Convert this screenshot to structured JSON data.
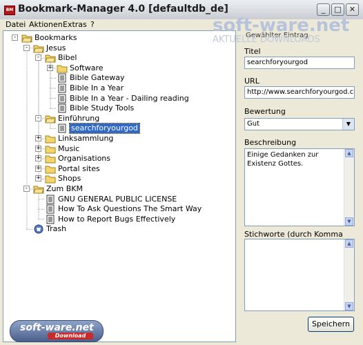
{
  "window": {
    "title": "Bookmark-Manager 4.0 [defaultdb_de]",
    "app_icon_text": "BM",
    "controls": {
      "minimize": "_",
      "maximize": "□",
      "close": "✕"
    }
  },
  "menubar": [
    "Datei",
    "Aktionen",
    "Extras",
    "?"
  ],
  "tree": [
    {
      "label": "Bookmarks",
      "type": "folder",
      "level": 0,
      "expander": "-"
    },
    {
      "label": "Jesus",
      "type": "folder",
      "level": 1,
      "expander": "-"
    },
    {
      "label": "Bibel",
      "type": "folder",
      "level": 2,
      "expander": "-"
    },
    {
      "label": "Software",
      "type": "folder",
      "level": 3,
      "expander": "+"
    },
    {
      "label": "Bible Gateway",
      "type": "doc",
      "level": 3
    },
    {
      "label": "Bible In a Year",
      "type": "doc",
      "level": 3
    },
    {
      "label": "Bible In a Year - Dailing reading",
      "type": "doc",
      "level": 3
    },
    {
      "label": "Bible Study Tools",
      "type": "doc",
      "level": 3
    },
    {
      "label": "Einführung",
      "type": "folder",
      "level": 2,
      "expander": "-"
    },
    {
      "label": "searchforyourgod",
      "type": "doc",
      "level": 3,
      "selected": true
    },
    {
      "label": "Linksammlung",
      "type": "folder",
      "level": 2,
      "expander": "+"
    },
    {
      "label": "Music",
      "type": "folder",
      "level": 2,
      "expander": "+"
    },
    {
      "label": "Organisations",
      "type": "folder",
      "level": 2,
      "expander": "+"
    },
    {
      "label": "Portal sites",
      "type": "folder",
      "level": 2,
      "expander": "+"
    },
    {
      "label": "Shops",
      "type": "folder",
      "level": 2,
      "expander": "+"
    },
    {
      "label": "Zum BKM",
      "type": "folder",
      "level": 1,
      "expander": "-"
    },
    {
      "label": "GNU GENERAL PUBLIC LICENSE",
      "type": "doc",
      "level": 2
    },
    {
      "label": "How To Ask Questions The Smart Way",
      "type": "doc",
      "level": 2
    },
    {
      "label": "How to Report Bugs Effectively",
      "type": "doc",
      "level": 2
    },
    {
      "label": "Trash",
      "type": "trash",
      "level": 1
    }
  ],
  "details": {
    "group_legend": "Gewählter Eintrag",
    "title_label": "Titel",
    "title_value": "searchforyourgod",
    "url_label": "URL",
    "url_value": "http://www.searchforyourgod.com/",
    "rating_label": "Bewertung",
    "rating_value": "Gut",
    "description_label": "Beschreibung",
    "description_value": "Einige Gedanken zur Existenz Gottes.",
    "keywords_label": "Stichworte (durch Komma trennen)",
    "keywords_value": "",
    "save_label": "Speichern"
  },
  "watermarks": {
    "top_main": "soft-ware.net",
    "top_sub": "AKTUELLE DOWNLOADS",
    "bottom_main": "soft-ware.net",
    "bottom_sub": "Download"
  },
  "colors": {
    "selection": "#316ac5",
    "folder": "#f2d56b",
    "tree_line": "#a0a0a0"
  }
}
